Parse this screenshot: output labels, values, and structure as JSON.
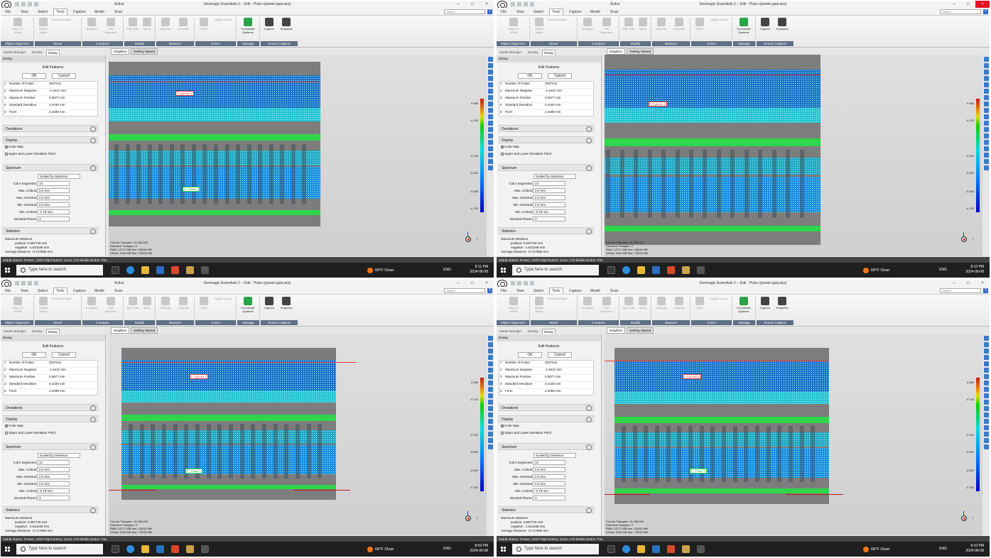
{
  "screens": [
    {
      "title": "Geomagic Essentials 2 -- Edit - Pista c(pinete-guia.wrp)",
      "active_label": "Active",
      "menu": [
        "File",
        "View",
        "Select",
        "Tools",
        "Capture",
        "Model",
        "Scan"
      ],
      "active_menu": "Tools",
      "search_placeholder": "Search",
      "time": "8:11 PM",
      "date": "2024-06-08",
      "cyl_label": "F Cylinder 1",
      "plane_label": "P - Plane 1",
      "close_red": false
    },
    {
      "title": "Geomagic Essentials 2 -- Edit - Pista c(pinete-guia.wrp)",
      "active_label": "Active",
      "menu": [
        "File",
        "View",
        "Select",
        "Tools",
        "Capture",
        "Model",
        "Scan"
      ],
      "active_menu": "Tools",
      "search_placeholder": "Search",
      "time": "8:10 PM",
      "date": "2024-06-08",
      "cyl_label": "F Cylinder 1",
      "plane_label": "",
      "close_red": true
    },
    {
      "title": "Geomagic Essentials 2 -- Edit - Pista c(pinete-guia.wrp)",
      "active_label": "Active",
      "menu": [
        "File",
        "View",
        "Select",
        "Tools",
        "Capture",
        "Model",
        "Scan"
      ],
      "active_menu": "Tools",
      "search_placeholder": "Search",
      "time": "8:09 PM",
      "date": "2024-06-08",
      "cyl_label": "F Cylinder 1",
      "plane_label": "P - Plane 1",
      "close_red": false
    },
    {
      "title": "Geomagic Essentials 2 -- Edit - Pista c(pinete-guia.wrp)",
      "active_label": "",
      "menu": [
        "File",
        "View",
        "Select",
        "Tools",
        "Capture",
        "Model",
        "Scan"
      ],
      "active_menu": "Tools",
      "search_placeholder": "Search",
      "time": "8:10 PM",
      "date": "2024-06-08",
      "cyl_label": "F Cylinder 1",
      "plane_label": "P - Plane 1",
      "close_red": false
    }
  ],
  "ribbon": {
    "groups": [
      "Object Alignment",
      "Mover",
      "Compare",
      "Modify",
      "Measure",
      "Colors",
      "Manage",
      "Screen Capture"
    ],
    "tools": [
      "Align To World",
      "Object Mover",
      "Reorient Model",
      "Reset Model",
      "Mover",
      "Deviation",
      "Edit Spectrum",
      "Edit Units",
      "Mirror",
      "Distance",
      "Compute",
      "Paint",
      "Adjust Colors",
      "Remove",
      "Coordinate Systems",
      "Capture",
      "Snapshot"
    ]
  },
  "panel_tabs": [
    "Model Manager",
    "Display",
    "Dialog"
  ],
  "view_tabs": [
    "Graphics",
    "Getting Started"
  ],
  "dialog": {
    "header": "Dialog",
    "title": "Edit Features",
    "ok": "OK",
    "cancel": "Cancel",
    "stats": [
      {
        "n": "1",
        "k": "Number of Points",
        "v": "2537441"
      },
      {
        "n": "2",
        "k": "Maximum Negative",
        "v": "-1.6412 mm"
      },
      {
        "n": "3",
        "k": "Maximum Positive",
        "v": "0.5877 mm"
      },
      {
        "n": "4",
        "k": "Standard Deviation",
        "v": "0.4150 mm"
      },
      {
        "n": "5",
        "k": "Form",
        "v": "2.2289 mm"
      }
    ],
    "sections": {
      "deviations": "Deviations",
      "display": "Display",
      "spectrum": "Spectrum",
      "statistics": "Statistics"
    },
    "color_map": "Color Map",
    "upper_lower": "Upper and Lower Deviation Point",
    "scaled": "Scaled by Selection",
    "fields": [
      {
        "k": "Color Segments:",
        "v": "14"
      },
      {
        "k": "Max. Critical:",
        "v": "0.0 mm"
      },
      {
        "k": "Max. Nominal:",
        "v": "0.0 mm"
      },
      {
        "k": "Min. Nominal:",
        "v": "0.0 mm"
      },
      {
        "k": "Min. Critical:",
        "v": "-0.75 mm"
      },
      {
        "k": "Decimal Places:",
        "v": "3"
      }
    ],
    "statistics": {
      "max_distance": "Maximum Distance",
      "positive": "positive: 0.587730 mm",
      "negative": "negative: -1.641168 mm",
      "average": "Average Distance: -0.717585 mm"
    }
  },
  "viewport": {
    "current_triangles": "Current Triangles: 15,908,053",
    "detected_triangles": "Detected Triangles: 0",
    "ram": "RAM: 14717 MB free / 65282 MB",
    "virtual": "Virtual: 9049 MB free / 76032 MB"
  },
  "colorbar": [
    "0.588",
    "-0.125",
    "-0.376",
    "-0.500",
    "-0.625",
    "-0.750"
  ],
  "status": "Middle Button: Rotate | Shift+Right Button: Zoom | Alt+Middle Button: Pan",
  "taskbar": {
    "search": "Type here to search",
    "weather": "69°F  Clear",
    "lang": "ENG"
  },
  "colors": {
    "accent": "#2f6ed0",
    "deviation_blue": "#1e73c8",
    "deviation_cyan": "#27c3d4",
    "point_green": "#2fd54a",
    "header_gray": "#5f6f86"
  }
}
